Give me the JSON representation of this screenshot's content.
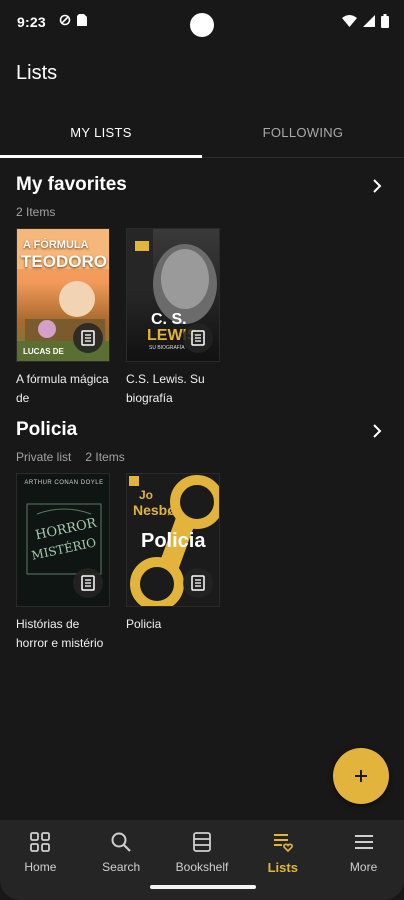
{
  "status_bar": {
    "time": "9:23"
  },
  "app_bar": {
    "title": "Lists"
  },
  "tabs": [
    {
      "label": "MY LISTS",
      "active": true
    },
    {
      "label": "FOLLOWING",
      "active": false
    }
  ],
  "lists": [
    {
      "title": "My favorites",
      "meta": [
        "2 Items"
      ],
      "books": [
        {
          "title": "A fórmula mágica de",
          "cover_lines": [
            "A FÓRMULA",
            "TEODORO",
            "LUCAS DE"
          ]
        },
        {
          "title": "C.S. Lewis. Su biografía",
          "cover_lines": [
            "C. S.",
            "LEWIS",
            "SU BIOGRAFÍA"
          ]
        }
      ]
    },
    {
      "title": "Policia",
      "meta": [
        "Private list",
        "2 Items"
      ],
      "books": [
        {
          "title": "Histórias de horror e mistério",
          "cover_lines": [
            "ARTHUR CONAN DOYLE",
            "HORROR",
            "MISTÉRIO"
          ]
        },
        {
          "title": "Policia",
          "cover_lines": [
            "Jo",
            "Nesbø",
            "Policia"
          ]
        }
      ]
    }
  ],
  "fab": {
    "icon": "plus-icon"
  },
  "bottom_nav": [
    {
      "label": "Home",
      "icon": "home-grid-icon",
      "active": false
    },
    {
      "label": "Search",
      "icon": "search-icon",
      "active": false
    },
    {
      "label": "Bookshelf",
      "icon": "bookshelf-icon",
      "active": false
    },
    {
      "label": "Lists",
      "icon": "list-heart-icon",
      "active": true
    },
    {
      "label": "More",
      "icon": "menu-icon",
      "active": false
    }
  ],
  "colors": {
    "background": "#181818",
    "accent": "#e2b43b",
    "nav_bg": "#252525"
  }
}
